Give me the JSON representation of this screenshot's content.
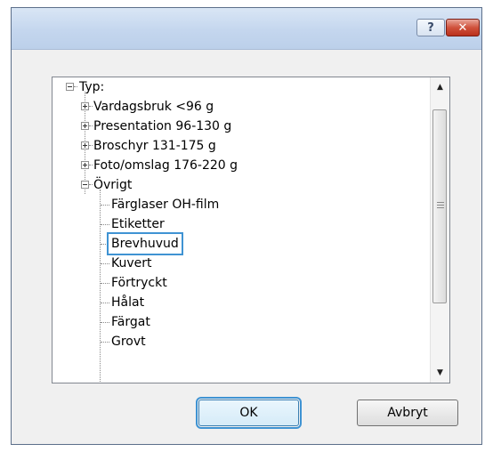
{
  "titlebar": {
    "help_label": "?",
    "close_label": "✕"
  },
  "tree": {
    "root_label": "Typ:",
    "items": [
      {
        "label": "Vardagsbruk <96 g"
      },
      {
        "label": "Presentation 96-130 g"
      },
      {
        "label": "Broschyr 131-175 g"
      },
      {
        "label": "Foto/omslag 176-220 g"
      },
      {
        "label": "Övrigt"
      }
    ],
    "children": [
      {
        "label": "Färglaser OH-film"
      },
      {
        "label": "Etiketter"
      },
      {
        "label": "Brevhuvud"
      },
      {
        "label": "Kuvert"
      },
      {
        "label": "Förtryckt"
      },
      {
        "label": "Hålat"
      },
      {
        "label": "Färgat"
      },
      {
        "label": "Grovt"
      }
    ],
    "selected_item": "Brevhuvud"
  },
  "scrollbar": {
    "up_arrow": "▲",
    "down_arrow": "▼"
  },
  "buttons": {
    "ok_label": "OK",
    "cancel_label": "Avbryt"
  },
  "colors": {
    "selection_outline": "#3f93d3",
    "titlebar": "#c4d6ee",
    "close_button": "#c8402a"
  }
}
